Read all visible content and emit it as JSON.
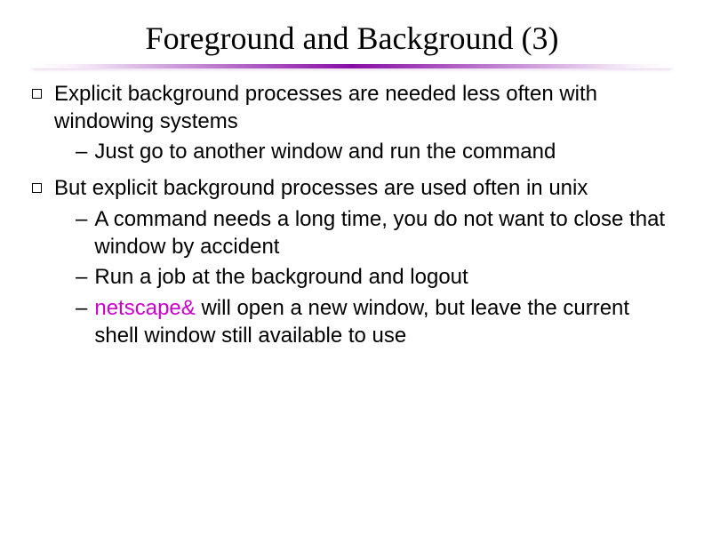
{
  "slide": {
    "title": "Foreground and Background (3)",
    "bullets": [
      {
        "text": "Explicit background processes are needed less often with windowing systems",
        "subs": [
          {
            "dash": "–",
            "text": "Just go to another window and run the command"
          }
        ]
      },
      {
        "text": "But explicit background processes are used often in unix",
        "subs": [
          {
            "dash": "–",
            "text": "A command needs a long time, you do not want to close that window by accident"
          },
          {
            "dash": "–",
            "text": "Run a job at the background and logout"
          },
          {
            "dash": "–",
            "command": "netscape&",
            "text": " will open a new window, but leave the current shell window still available to use"
          }
        ]
      }
    ]
  }
}
